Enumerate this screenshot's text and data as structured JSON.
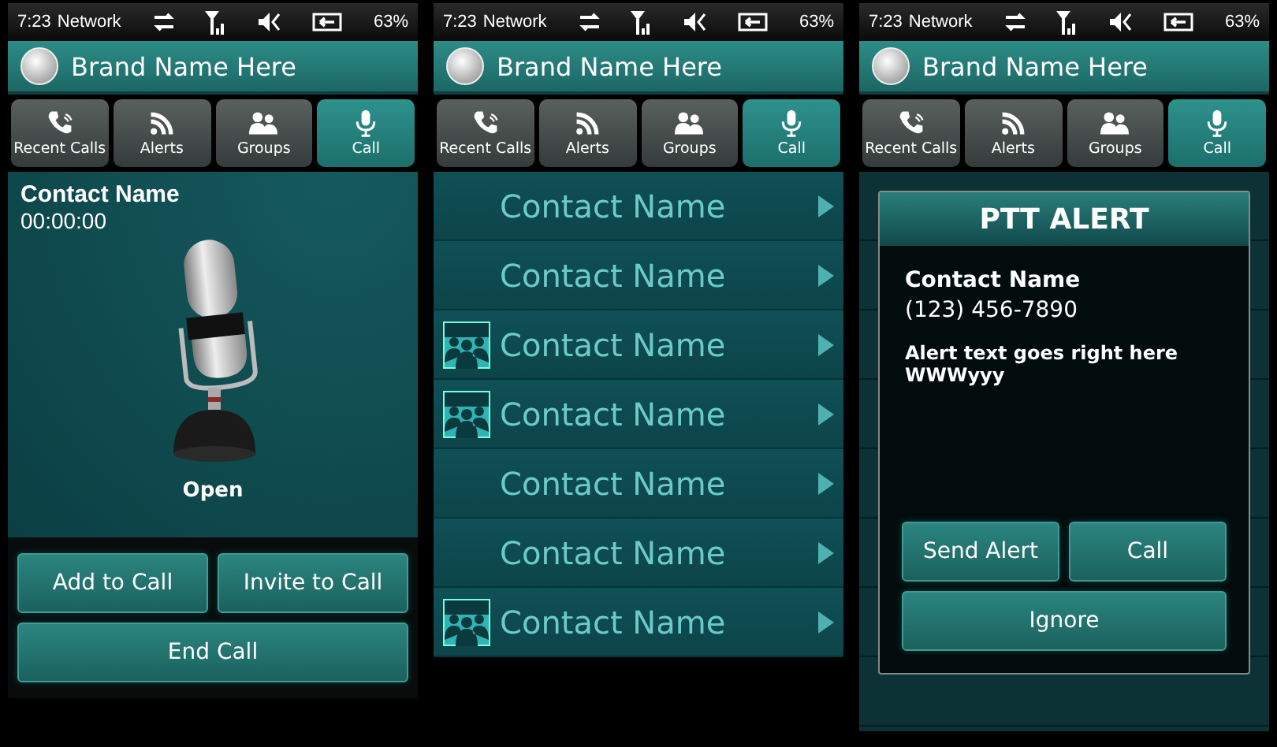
{
  "screens": [
    {
      "status_bar": {
        "time": "7:23",
        "network": "Network",
        "battery": "63%"
      },
      "header": {
        "title": "Brand Name Here"
      },
      "tabs": [
        {
          "label": "Recent Calls",
          "selected": false
        },
        {
          "label": "Alerts",
          "selected": false
        },
        {
          "label": "Groups",
          "selected": false
        },
        {
          "label": "Call",
          "selected": true
        }
      ],
      "content": {
        "kind": "call",
        "contact": "Contact Name",
        "timer": "00:00:00",
        "state": "Open",
        "buttons": [
          "Add to Call",
          "Invite to Call",
          "End Call"
        ]
      }
    },
    {
      "status_bar": {
        "time": "7:23",
        "network": "Network",
        "battery": "63%"
      },
      "header": {
        "title": "Brand Name Here"
      },
      "tabs": [
        {
          "label": "Recent Calls",
          "selected": false
        },
        {
          "label": "Alerts",
          "selected": false
        },
        {
          "label": "Groups",
          "selected": false
        },
        {
          "label": "Call",
          "selected": true
        }
      ],
      "content": {
        "kind": "list",
        "rows": [
          {
            "name": "Contact Name",
            "group": false
          },
          {
            "name": "Contact Name",
            "group": false
          },
          {
            "name": "Contact Name",
            "group": true
          },
          {
            "name": "Contact Name",
            "group": true
          },
          {
            "name": "Contact Name",
            "group": false
          },
          {
            "name": "Contact Name",
            "group": false
          },
          {
            "name": "Contact Name",
            "group": true
          }
        ]
      }
    },
    {
      "status_bar": {
        "time": "7:23",
        "network": "Network",
        "battery": "63%"
      },
      "header": {
        "title": "Brand Name Here"
      },
      "tabs": [
        {
          "label": "Recent Calls",
          "selected": false
        },
        {
          "label": "Alerts",
          "selected": false
        },
        {
          "label": "Groups",
          "selected": false
        },
        {
          "label": "Call",
          "selected": true
        }
      ],
      "content": {
        "kind": "alert",
        "title": "PTT ALERT",
        "contact": "Contact Name",
        "phone": "(123) 456-7890",
        "message": "Alert text goes right here\nWWWyyy",
        "buttons": [
          "Send Alert",
          "Call",
          "Ignore"
        ]
      }
    }
  ]
}
